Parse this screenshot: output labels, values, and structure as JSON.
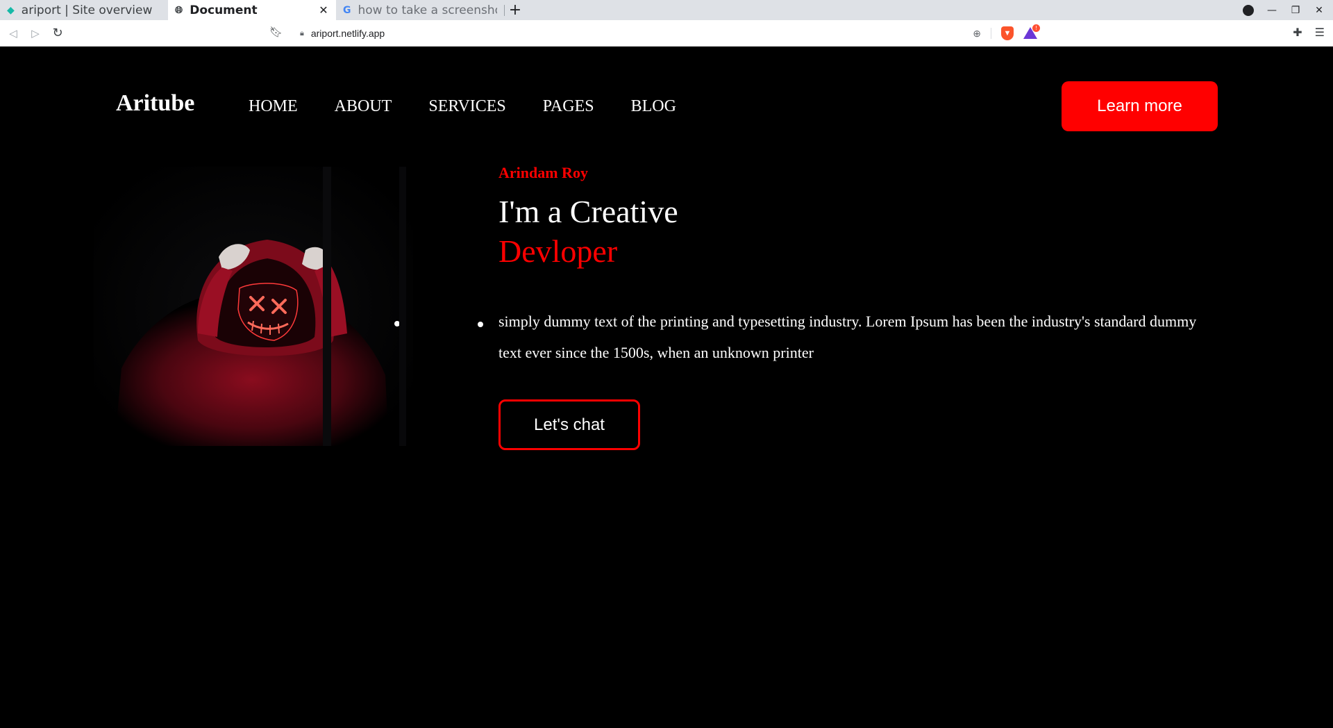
{
  "browser": {
    "tabs": [
      {
        "title": "ariport | Site overview",
        "icon": "netlify-diamond-icon",
        "active": false
      },
      {
        "title": "Document",
        "icon": "globe-icon",
        "active": true
      },
      {
        "title": "how to take a screenshot",
        "icon": "google-g-icon",
        "active": false
      }
    ],
    "new_tab_glyph": "+",
    "url": "ariport.netlify.app",
    "colors": {
      "tabbar": "#dee1e6",
      "brave": "#fb542b",
      "rewards": "#6b37d6"
    }
  },
  "site": {
    "logo": "Aritube",
    "nav": [
      "HOME",
      "ABOUT",
      "SERVICES",
      "PAGES",
      "BLOG"
    ],
    "cta_label": "Learn more",
    "author": "Arindam Roy",
    "headline_line1": "I'm a Creative",
    "headline_line2": "Devloper",
    "description": "simply dummy text of the printing and typesetting industry. Lorem Ipsum has been the industry's standard dummy text ever since the 1500s, when an unknown printer",
    "chat_label": "Let's chat",
    "colors": {
      "accent": "#ff0000",
      "background": "#000000",
      "text": "#ffffff"
    }
  }
}
